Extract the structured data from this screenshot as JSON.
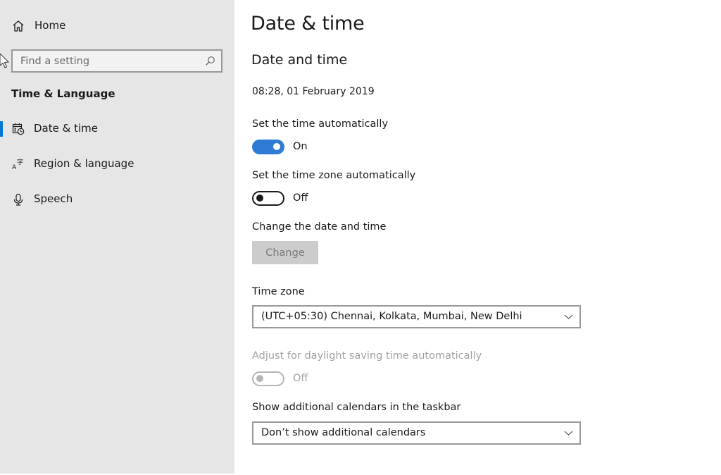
{
  "sidebar": {
    "home_label": "Home",
    "search": {
      "placeholder": "Find a setting",
      "value": ""
    },
    "section_title": "Time & Language",
    "items": [
      {
        "label": "Date & time",
        "icon": "calendar-clock-icon",
        "selected": true
      },
      {
        "label": "Region & language",
        "icon": "language-icon",
        "selected": false
      },
      {
        "label": "Speech",
        "icon": "microphone-icon",
        "selected": false
      }
    ]
  },
  "main": {
    "page_title": "Date & time",
    "subheading": "Date and time",
    "current_datetime": "08:28, 01 February 2019",
    "set_time_auto": {
      "label": "Set the time automatically",
      "state": "On",
      "enabled": true
    },
    "set_timezone_auto": {
      "label": "Set the time zone automatically",
      "state": "Off",
      "enabled": false
    },
    "change_datetime": {
      "label": "Change the date and time",
      "button_label": "Change",
      "button_disabled": true
    },
    "time_zone": {
      "label": "Time zone",
      "selected": "(UTC+05:30) Chennai, Kolkata, Mumbai, New Delhi"
    },
    "daylight_saving": {
      "label": "Adjust for daylight saving time automatically",
      "state": "Off",
      "disabled": true
    },
    "additional_calendars": {
      "label": "Show additional calendars in the taskbar",
      "selected": "Don’t show additional calendars"
    }
  },
  "colors": {
    "accent": "#0078d7",
    "toggle_on": "#2e7bd6",
    "sidebar_bg": "#e6e6e6",
    "disabled_text": "#a0a0a0"
  }
}
